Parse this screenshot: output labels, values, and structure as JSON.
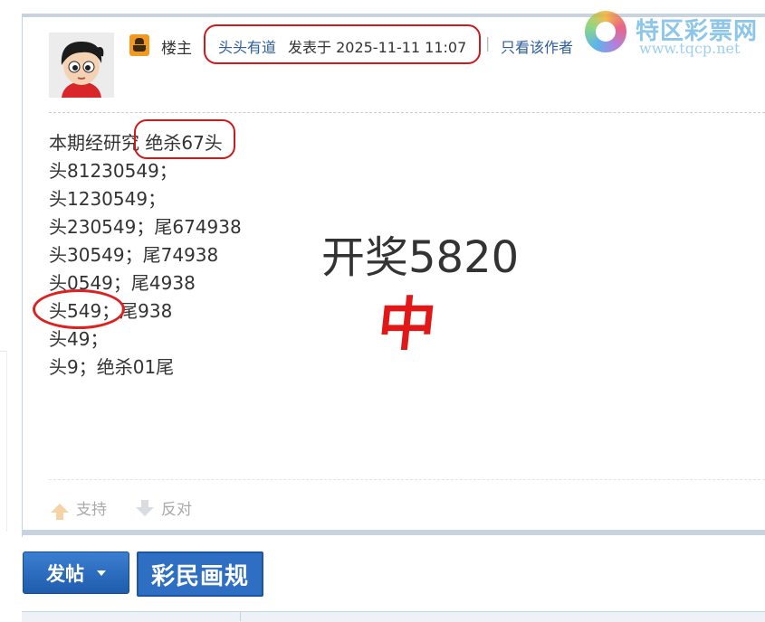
{
  "post": {
    "owner_label": "楼主",
    "author": "头头有道",
    "posted_at": "发表于 2025-11-11 11:07",
    "separator": "|",
    "only_author": "只看该作者",
    "content_lines": [
      "本期经研究 绝杀67头",
      "头81230549；",
      "头1230549；",
      "头230549；尾674938",
      "头30549；尾74938",
      "头0549；尾4938",
      "头549；尾938",
      "头49；",
      "头9；绝杀01尾"
    ],
    "overlay_text": "开奖5820",
    "overlay_hit": "中",
    "support_label": "支持",
    "oppose_label": "反对"
  },
  "watermark": {
    "cn": "特区彩票网",
    "url": "www.tqcp.net"
  },
  "actions": {
    "post_button": "发帖",
    "rules_button": "彩民画规"
  },
  "colors": {
    "link": "#2b5d9e",
    "highlight_red": "#cc1b1b",
    "button_blue": "#2f6fc3",
    "frame": "#c7d4df"
  }
}
